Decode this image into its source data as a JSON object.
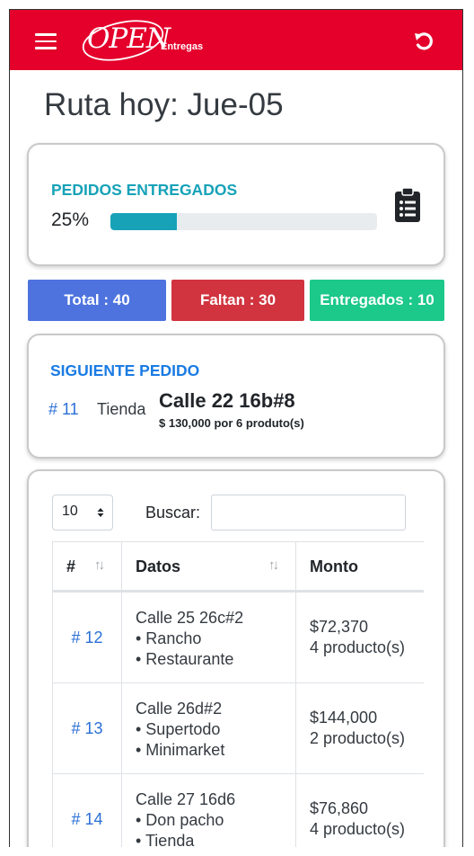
{
  "header": {
    "logo_text": "OPEN",
    "logo_sub": "Entregas",
    "menu_icon": "hamburger-menu-icon",
    "refresh_icon": "refresh-icon",
    "color": "#e4002b"
  },
  "page": {
    "title": "Ruta hoy: Jue-05"
  },
  "progress": {
    "label": "PEDIDOS ENTREGADOS",
    "percent_text": "25%",
    "percent": 25,
    "icon": "clipboard-list-icon",
    "color": "#17a2b8"
  },
  "counters": {
    "total": "Total : 40",
    "faltan": "Faltan : 30",
    "entregados": "Entregados : 10"
  },
  "next_order": {
    "label": "SIGUIENTE PEDIDO",
    "number": "# 11",
    "type": "Tienda",
    "address": "Calle 22 16b#8",
    "summary": "$ 130,000 por 6 produto(s)"
  },
  "table": {
    "page_length": "10",
    "search_label": "Buscar:",
    "search_value": "",
    "columns": [
      "#",
      "Datos",
      "Monto"
    ],
    "rows": [
      {
        "num": "# 12",
        "datos": [
          "Calle 25 26c#2",
          "• Rancho",
          "• Restaurante"
        ],
        "monto": [
          "$72,370",
          "4 producto(s)"
        ]
      },
      {
        "num": "# 13",
        "datos": [
          "Calle 26d#2",
          "• Supertodo",
          "• Minimarket"
        ],
        "monto": [
          "$144,000",
          "2 producto(s)"
        ]
      },
      {
        "num": "# 14",
        "datos": [
          "Calle 27 16d6",
          "• Don pacho",
          "• Tienda"
        ],
        "monto": [
          "$76,860",
          "4 producto(s)"
        ]
      }
    ]
  }
}
